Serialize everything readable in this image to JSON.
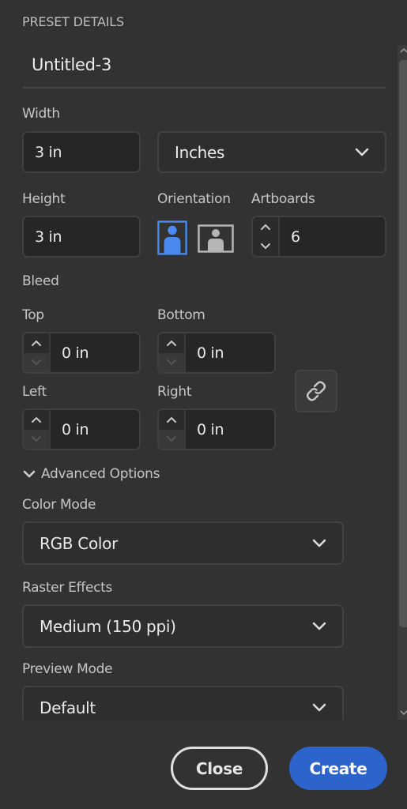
{
  "header": {
    "title": "PRESET DETAILS"
  },
  "document_name": "Untitled-3",
  "width": {
    "label": "Width",
    "value": "3 in"
  },
  "units": {
    "selected": "Inches",
    "icon": "chevron-down-icon"
  },
  "height": {
    "label": "Height",
    "value": "3 in"
  },
  "orientation": {
    "label": "Orientation",
    "options": [
      {
        "name": "portrait",
        "selected": true,
        "icon": "portrait-orientation-icon"
      },
      {
        "name": "landscape",
        "selected": false,
        "icon": "landscape-orientation-icon"
      }
    ]
  },
  "artboards": {
    "label": "Artboards",
    "value": "6"
  },
  "bleed": {
    "label": "Bleed",
    "top": {
      "label": "Top",
      "value": "0 in"
    },
    "bottom": {
      "label": "Bottom",
      "value": "0 in"
    },
    "left": {
      "label": "Left",
      "value": "0 in"
    },
    "right": {
      "label": "Right",
      "value": "0 in"
    },
    "link_icon": "link-icon"
  },
  "advanced": {
    "label": "Advanced Options",
    "expanded": true,
    "color_mode": {
      "label": "Color Mode",
      "selected": "RGB Color"
    },
    "raster_effects": {
      "label": "Raster Effects",
      "selected": "Medium (150 ppi)"
    },
    "preview_mode": {
      "label": "Preview Mode",
      "selected": "Default"
    }
  },
  "footer": {
    "close_label": "Close",
    "create_label": "Create"
  },
  "colors": {
    "accent": "#2d64cc",
    "selected_orientation": "#4a8af0",
    "background": "#323232"
  }
}
